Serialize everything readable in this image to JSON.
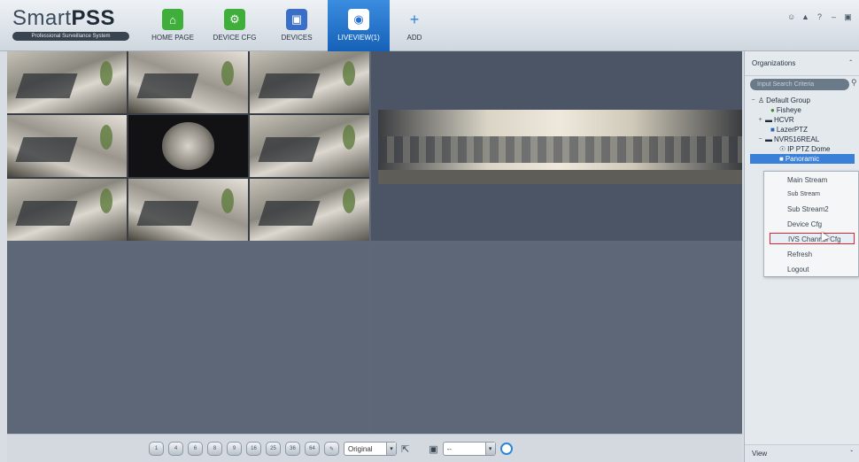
{
  "app": {
    "logo_main": "Smart",
    "logo_bold": "PSS",
    "logo_sub": "Professional Surveillance System"
  },
  "nav": {
    "tabs": [
      {
        "label": "HOME PAGE",
        "icon": "home-icon",
        "color": "#3fae3a"
      },
      {
        "label": "DEVICE CFG",
        "icon": "device-config-icon",
        "color": "#3fae3a"
      },
      {
        "label": "DEVICES",
        "icon": "devices-icon",
        "color": "#3a6fc8"
      },
      {
        "label": "LIVEVIEW(1)",
        "icon": "liveview-icon",
        "color": "#2a6fd0",
        "active": true
      },
      {
        "label": "ADD",
        "icon": "add-icon",
        "color": "#2a86d8"
      }
    ]
  },
  "window_controls": [
    "user-icon",
    "lock-icon",
    "help-icon",
    "minimize-icon",
    "restore-icon"
  ],
  "toolbar": {
    "layout_buttons": [
      "1",
      "4",
      "6",
      "8",
      "9",
      "16",
      "25",
      "36",
      "64"
    ],
    "ratio_select": "Original",
    "stream_select": "--"
  },
  "organizations": {
    "title": "Organizations",
    "search_placeholder": "Input Search Criteria",
    "tree": [
      {
        "label": "Default Group",
        "level": 0,
        "toggle": "−",
        "icon": "group-icon"
      },
      {
        "label": "Fisheye",
        "level": 1,
        "toggle": "",
        "icon": "camera-icon"
      },
      {
        "label": "HCVR",
        "level": 1,
        "toggle": "+",
        "icon": "dvr-icon"
      },
      {
        "label": "LazerPTZ",
        "level": 1,
        "toggle": "",
        "icon": "camera-icon"
      },
      {
        "label": "NVR516REAL",
        "level": 1,
        "toggle": "−",
        "icon": "nvr-icon"
      },
      {
        "label": "IP PTZ Dome",
        "level": 2,
        "toggle": "",
        "icon": "ptz-icon"
      },
      {
        "label": "Panoramic",
        "level": 2,
        "toggle": "",
        "icon": "camera-icon",
        "selected": true
      }
    ]
  },
  "context_menu": {
    "items": [
      "Main Stream",
      "Sub Stream",
      "Sub Stream2",
      "Device Cfg",
      "IVS Channel Cfg",
      "Refresh",
      "Logout"
    ],
    "highlighted": "IVS Channel Cfg"
  },
  "view_panel": {
    "title": "View"
  }
}
